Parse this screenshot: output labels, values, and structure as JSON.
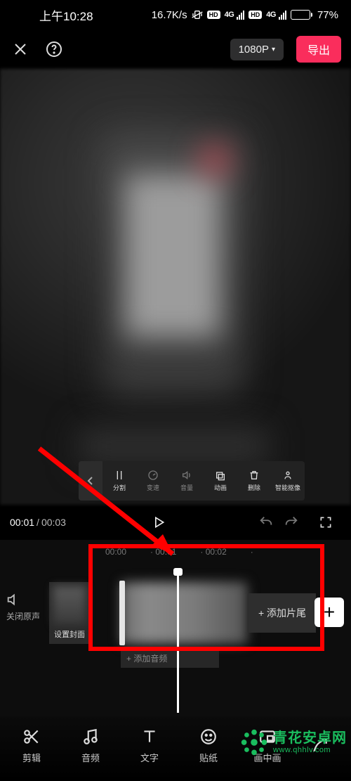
{
  "status": {
    "time": "上午10:28",
    "net_speed": "16.7K/s",
    "hd1": "HD",
    "fg1": "4G",
    "hd2": "HD",
    "fg2": "4G",
    "battery_pct": "77%"
  },
  "topbar": {
    "resolution": "1080P",
    "export": "导出"
  },
  "mini_tools": {
    "items": [
      {
        "label": "分割"
      },
      {
        "label": "变速"
      },
      {
        "label": "音量"
      },
      {
        "label": "动画"
      },
      {
        "label": "删除"
      },
      {
        "label": "智能抠像"
      }
    ]
  },
  "playback": {
    "current": "00:01",
    "total": "00:03"
  },
  "ruler": {
    "t0": "00:00",
    "t1": "00:01",
    "t2": "00:02"
  },
  "timeline": {
    "mute_label": "关闭原声",
    "cover_label": "设置封面",
    "add_tail": "+ 添加片尾",
    "add_audio": "+ 添加音频"
  },
  "bottom": {
    "edit": "剪辑",
    "audio": "音频",
    "text": "文字",
    "sticker": "贴纸",
    "pip": "画中画"
  },
  "watermark": {
    "cn": "青花安卓网",
    "en": "www.qhhlv.com"
  }
}
